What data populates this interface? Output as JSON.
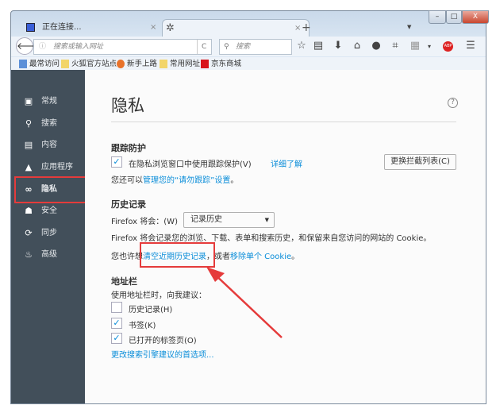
{
  "tabs": [
    {
      "label": "正在连接...",
      "close": "×"
    },
    {
      "label": "",
      "close": "×"
    }
  ],
  "new_tab": "+",
  "window_controls": {
    "min": "–",
    "max": "□",
    "close": "X"
  },
  "navbar": {
    "url_placeholder": "搜索或输入网址",
    "search_placeholder": "搜索",
    "reload": "C"
  },
  "bookmarks": [
    "最常访问",
    "火狐官方站点",
    "新手上路",
    "常用网址",
    "京东商城"
  ],
  "sidebar": {
    "items": [
      {
        "label": "常规",
        "icon": "general-icon"
      },
      {
        "label": "搜索",
        "icon": "search-icon"
      },
      {
        "label": "内容",
        "icon": "content-icon"
      },
      {
        "label": "应用程序",
        "icon": "applications-icon"
      },
      {
        "label": "隐私",
        "icon": "privacy-mask-icon",
        "selected": true
      },
      {
        "label": "安全",
        "icon": "security-icon"
      },
      {
        "label": "同步",
        "icon": "sync-icon"
      },
      {
        "label": "高级",
        "icon": "advanced-icon"
      }
    ]
  },
  "main": {
    "title": "隐私",
    "help": "?",
    "tracking": {
      "heading": "跟踪防护",
      "checkbox_label": "在隐私浏览窗口中使用跟踪保护(V)",
      "checked": true,
      "learn_more": "详细了解",
      "change_list_button": "更换拦截列表(C)",
      "dnt_prefix": "您还可以",
      "dnt_link": "管理您的“请勿跟踪”设置",
      "dnt_suffix": "。"
    },
    "history": {
      "heading": "历史记录",
      "will_label": "Firefox 将会：(W)",
      "select_value": "记录历史",
      "description": "Firefox 将会记录您的浏览、下载、表单和搜索历史，和保留来自您访问的网站的 Cookie。",
      "maybe_prefix": "您也许想",
      "clear_link": "清空近期历史记录",
      "maybe_mid": "，或者",
      "remove_cookie_link": "移除单个 Cookie",
      "maybe_suffix": "。"
    },
    "locationbar": {
      "heading": "地址栏",
      "intro": "使用地址栏时，向我建议：",
      "options": [
        {
          "label": "历史记录(H)",
          "checked": false
        },
        {
          "label": "书签(K)",
          "checked": true
        },
        {
          "label": "已打开的标签页(O)",
          "checked": true
        }
      ],
      "search_pref_link": "更改搜索引擎建议的首选项..."
    }
  },
  "colors": {
    "accent": "#0a8dd9",
    "highlight": "#e53b3b",
    "sidebar": "#424f5a"
  }
}
